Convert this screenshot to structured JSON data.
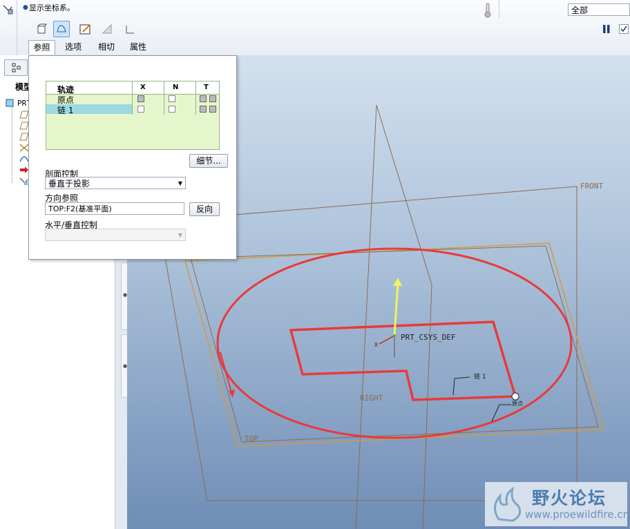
{
  "header": {
    "hint_text": "显示坐标系。",
    "filter_value": "全部"
  },
  "toolbar": {
    "tabs": [
      {
        "label": "参照"
      },
      {
        "label": "选项"
      },
      {
        "label": "相切"
      },
      {
        "label": "属性"
      }
    ]
  },
  "model_tree": {
    "tab_label": "模型",
    "root_label": "PRT"
  },
  "dialog": {
    "table": {
      "headers": [
        "轨迹",
        "X",
        "N",
        "T"
      ],
      "rows": [
        {
          "label": "原点"
        },
        {
          "label": "链 1"
        }
      ]
    },
    "details_button": "细节...",
    "section_control_label": "剖面控制",
    "section_control_value": "垂直于投影",
    "direction_ref_label": "方向参照",
    "direction_ref_value": "TOP:F2(基准平面)",
    "flip_button": "反向",
    "hv_control_label": "水平/垂直控制",
    "hv_control_value": ""
  },
  "viewport": {
    "labels": {
      "front": "FRONT",
      "right": "RIGHT",
      "top": "TOP",
      "csys": "PRT_CSYS_DEF",
      "chain": "链 1",
      "origin": "原点",
      "csys_x": "X"
    },
    "colors": {
      "plane": "#d49a3c",
      "plane_dark": "#8b6b52",
      "trajectory": "#e83a3a",
      "arrow": "#f2f25a"
    }
  },
  "watermark": {
    "name": "野火论坛",
    "url": "www.proewildfire.cn"
  }
}
